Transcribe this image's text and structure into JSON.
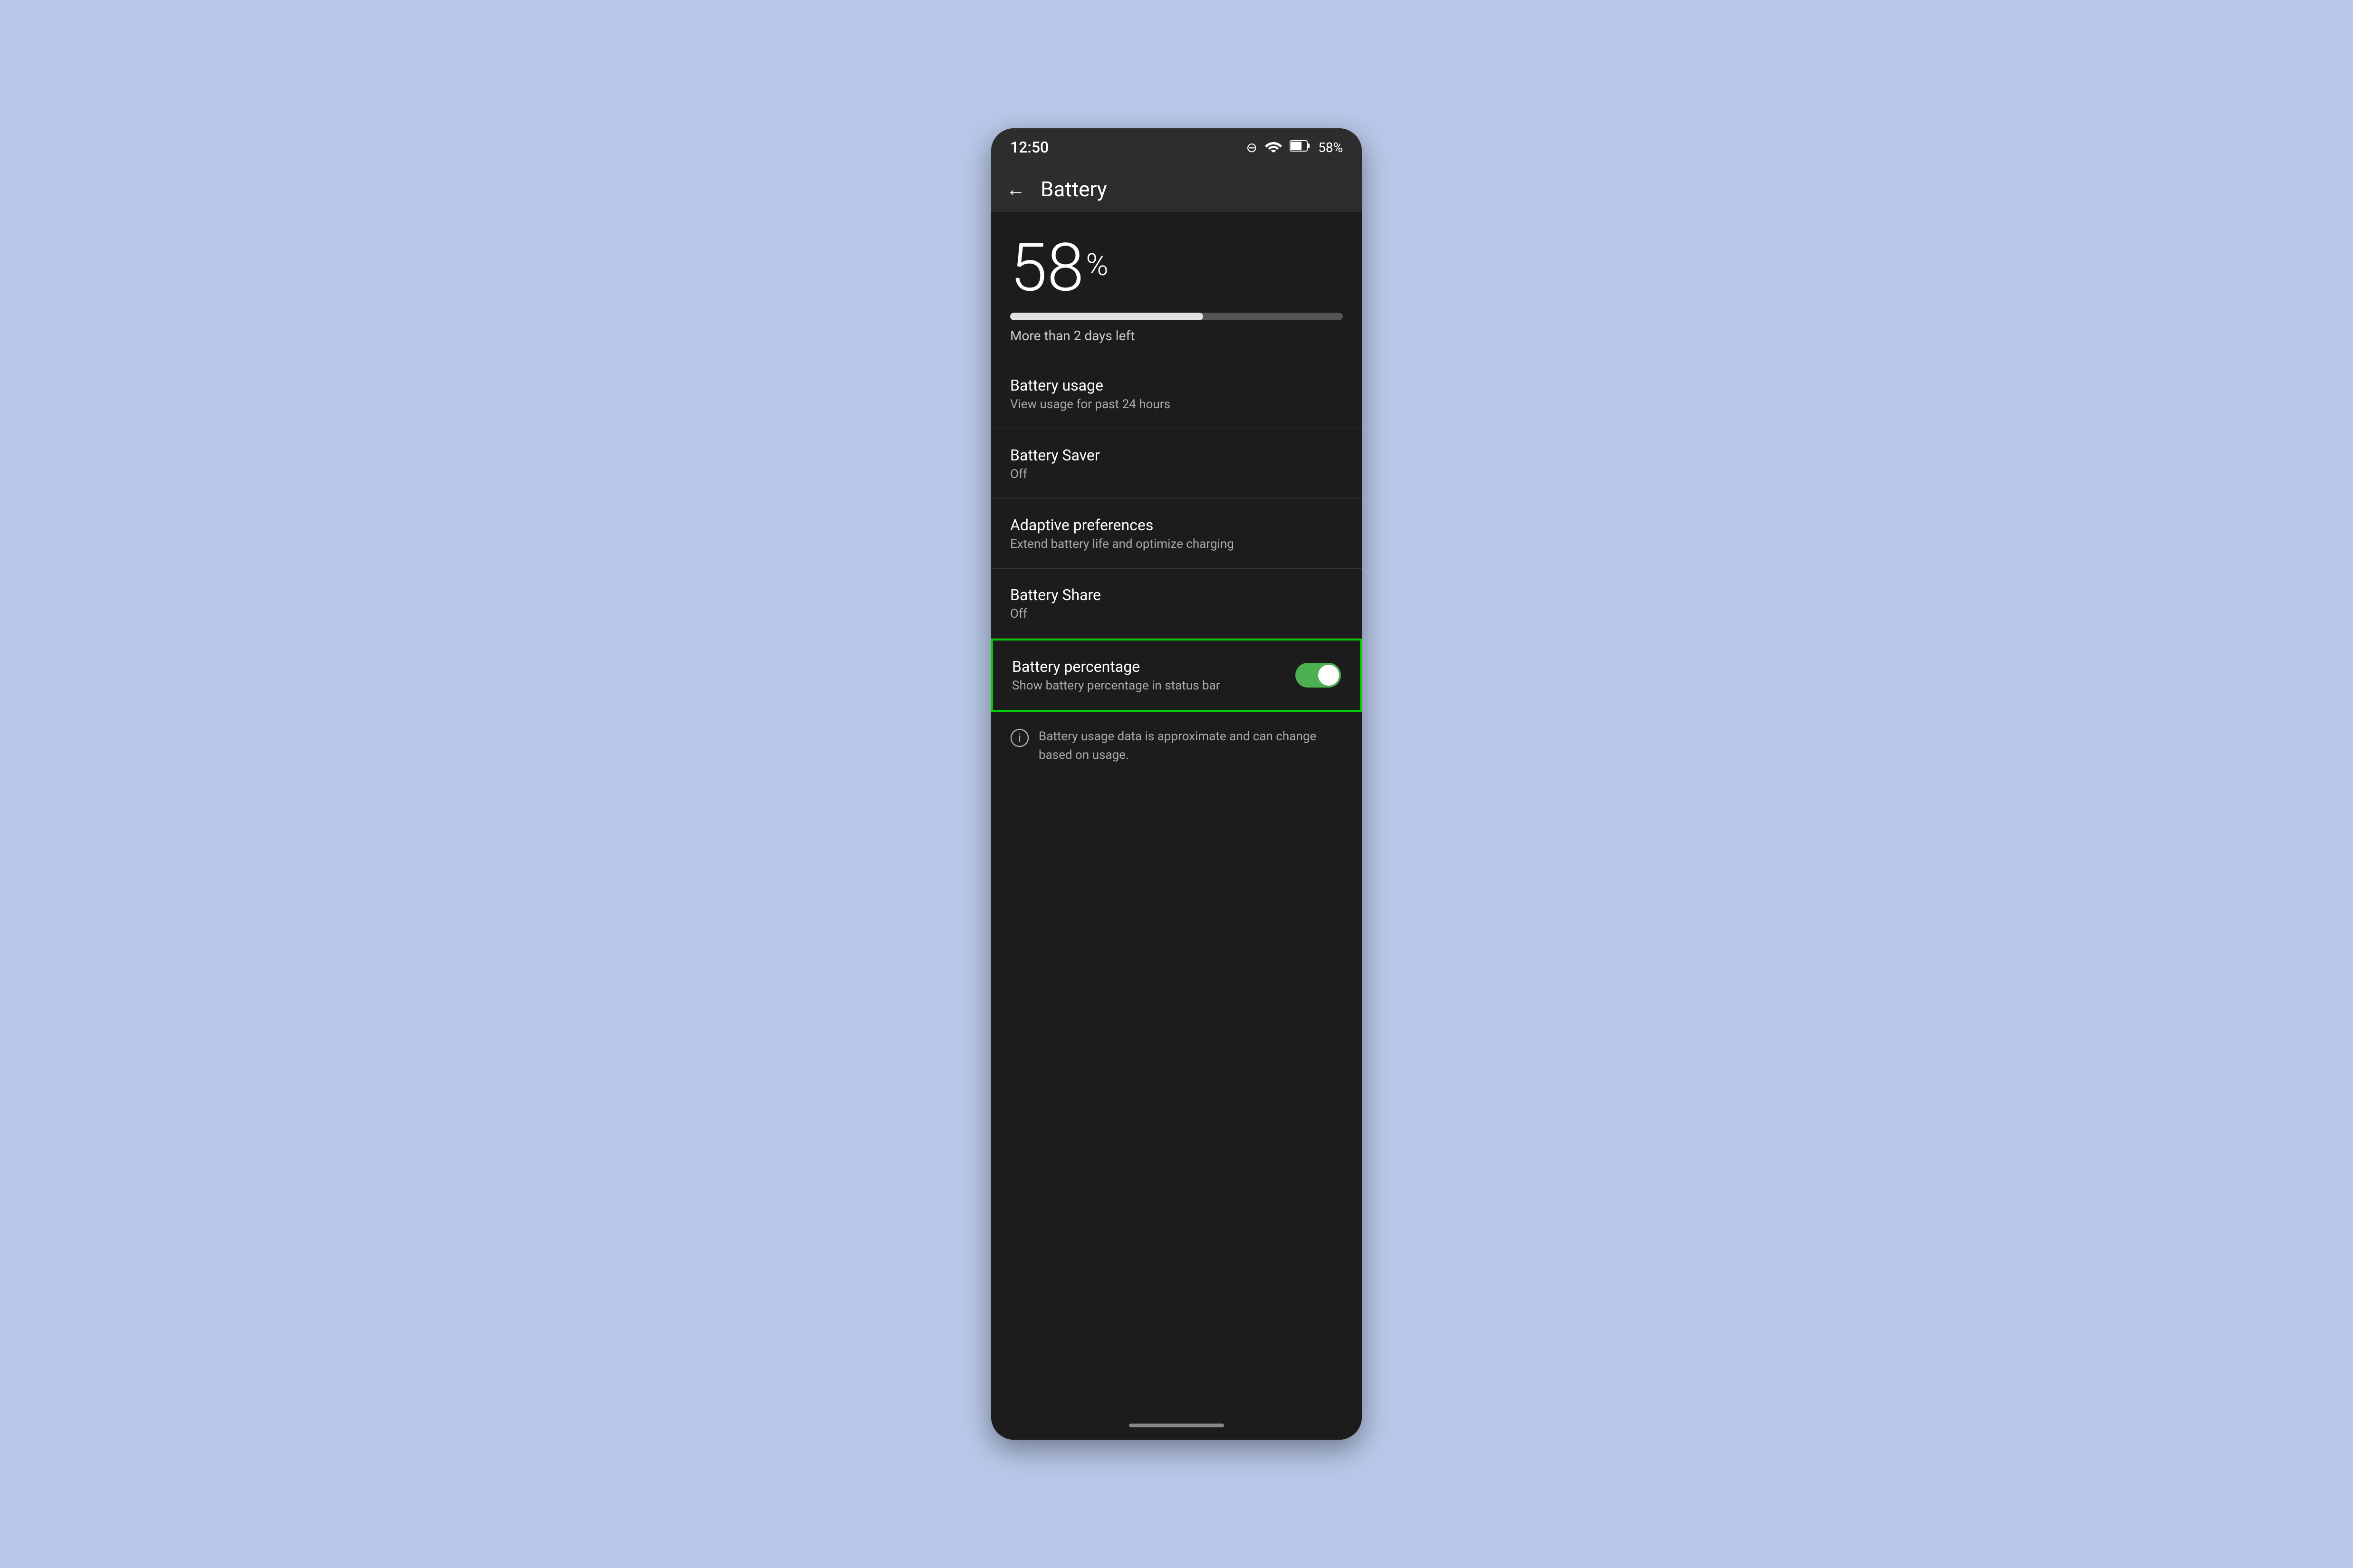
{
  "statusBar": {
    "time": "12:50",
    "batteryPercent": "58%"
  },
  "topBar": {
    "title": "Battery",
    "backLabel": "←"
  },
  "batteryHeader": {
    "percentage": "58",
    "percentSign": "%",
    "daysLeft": "More than 2 days left",
    "progressFill": 58
  },
  "settings": {
    "batteryUsage": {
      "title": "Battery usage",
      "subtitle": "View usage for past 24 hours"
    },
    "batterySaver": {
      "title": "Battery Saver",
      "value": "Off"
    },
    "adaptivePreferences": {
      "title": "Adaptive preferences",
      "subtitle": "Extend battery life and optimize charging"
    },
    "batteryShare": {
      "title": "Battery Share",
      "value": "Off"
    },
    "batteryPercentage": {
      "title": "Battery percentage",
      "subtitle": "Show battery percentage in status bar",
      "toggleOn": true
    }
  },
  "infoSection": {
    "text": "Battery usage data is approximate and can change based on usage."
  }
}
